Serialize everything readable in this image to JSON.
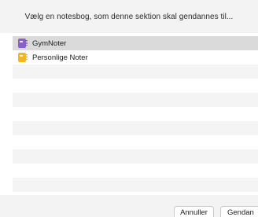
{
  "dialog": {
    "title": "Vælg en notesbog, som denne sektion skal gendannes til..."
  },
  "notebooks": [
    {
      "name": "GymNoter",
      "icon": "notebook-icon",
      "color": "#8b5fc8",
      "selected": true
    },
    {
      "name": "Personlige Noter",
      "icon": "notebook-icon",
      "color": "#f2b81e",
      "selected": false
    }
  ],
  "buttons": {
    "cancel_label": "Annuller",
    "restore_label": "Gendan"
  },
  "colors": {
    "header_bg": "#f3f3f3",
    "selected_row": "#dadada",
    "alt_row": "#f4f4f4"
  }
}
